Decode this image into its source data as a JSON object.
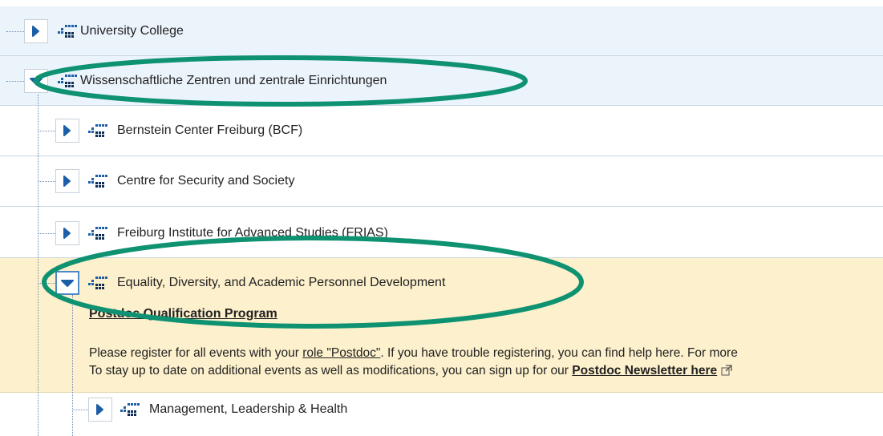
{
  "tree": {
    "items": [
      {
        "label": "University College"
      },
      {
        "label": "Wissenschaftliche Zentren und zentrale Einrichtungen"
      },
      {
        "label": "Bernstein Center Freiburg (BCF)"
      },
      {
        "label": "Centre for Security and Society"
      },
      {
        "label": "Freiburg Institute for Advanced Studies (FRIAS)"
      },
      {
        "label": "Equality, Diversity, and Academic Personnel Development"
      },
      {
        "label": "Management, Leadership & Health"
      }
    ],
    "expanded_panel": {
      "title": "Postdoc Qualification Program",
      "line1_prefix": "Please register for all events with your ",
      "line1_link": "role \"Postdoc\"",
      "line1_suffix": ". If you have trouble registering, you can find help here. For more",
      "line2_prefix": "To stay up to date on additional events as well as modifications, you can sign up for our ",
      "line2_link": "Postdoc Newsletter here"
    }
  },
  "annotations": {
    "color": "#0e9271"
  },
  "icons": {
    "collapsed": "chevron-right-icon",
    "expanded": "chevron-down-icon",
    "org_unit": "org-unit-icon",
    "external_link": "external-link-icon"
  }
}
